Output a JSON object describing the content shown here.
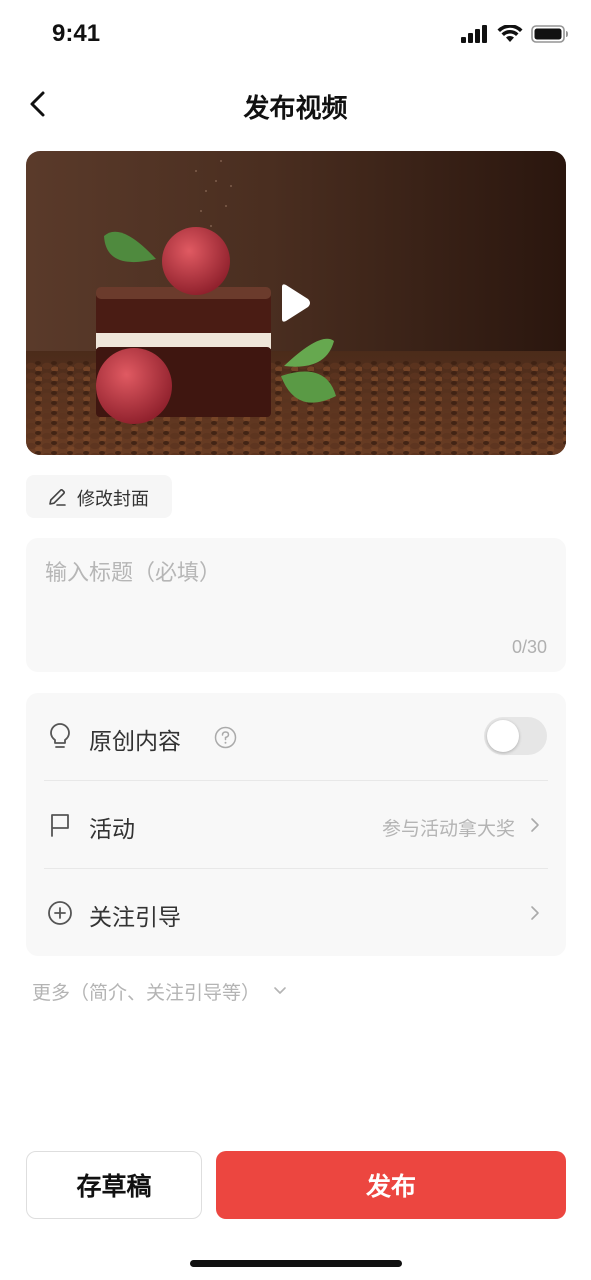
{
  "status_bar": {
    "time": "9:41",
    "icons": [
      "signal-icon",
      "wifi-icon",
      "battery-icon"
    ]
  },
  "nav": {
    "title": "发布视频",
    "back_icon": "chevron-left-icon"
  },
  "video": {
    "cover_description_icon": "play-icon"
  },
  "edit_cover": {
    "label": "修改封面",
    "icon": "pencil-icon"
  },
  "title_field": {
    "placeholder": "输入标题（必填）",
    "value": "",
    "counter": "0/30"
  },
  "options": {
    "original": {
      "label": "原创内容",
      "icon": "lightbulb-icon",
      "help_icon": "question-circle-icon",
      "toggle_on": false
    },
    "activity": {
      "label": "活动",
      "hint": "参与活动拿大奖",
      "icon": "flag-icon"
    },
    "follow_guide": {
      "label": "关注引导",
      "icon": "plus-circle-icon"
    }
  },
  "more": {
    "label": "更多（简介、关注引导等）",
    "icon": "chevron-down-icon"
  },
  "actions": {
    "draft_label": "存草稿",
    "publish_label": "发布"
  },
  "colors": {
    "accent": "#ec4640",
    "card_bg": "#f8f8f8",
    "hint_text": "#b4b4b4"
  }
}
